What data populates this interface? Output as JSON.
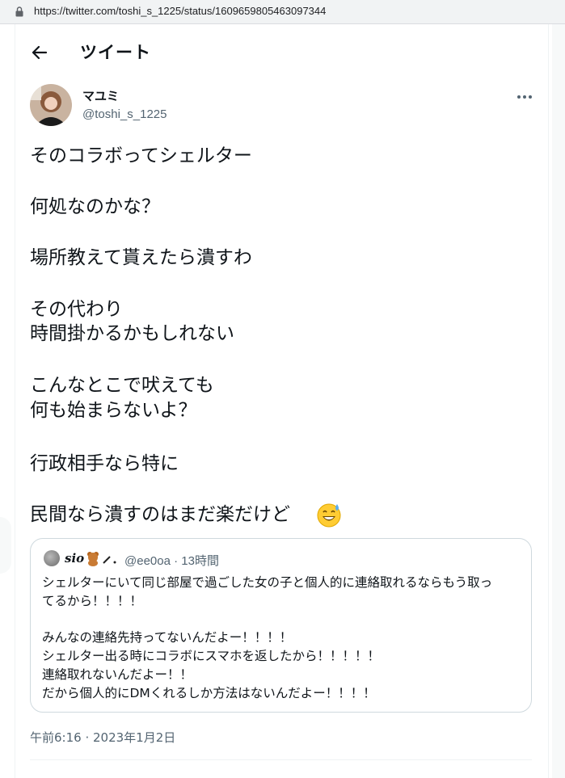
{
  "browser": {
    "url": "https://twitter.com/toshi_s_1225/status/1609659805463097344",
    "lock_icon": "lock-icon"
  },
  "header": {
    "back_icon": "arrow-left-icon",
    "title": "ツイート"
  },
  "tweet": {
    "author": {
      "display_name": "マユミ",
      "handle": "@toshi_s_1225"
    },
    "more_icon": "more-horizontal-icon",
    "lines": [
      "そのコラボってシェルター",
      "何処なのかな？",
      "場所教えて貰えたら潰すわ",
      "その代わり",
      "時間掛かるかもしれない",
      "こんなとこで吠えても",
      "何も始まらないよ？",
      "行政相手なら特に",
      "民間なら潰すのはまだ楽だけど"
    ],
    "trailing_emoji": "grinning-face-with-sweat-emoji",
    "timestamp": "午前6:16 · 2023年1月2日"
  },
  "quote": {
    "author_name": "sio",
    "name_decoration": "teddy-bear-emoji",
    "handle_time": "@ee0oa · 13時間",
    "lines": [
      "シェルターにいて同じ部屋で過ごした女の子と個人的に連絡取れるならもう取っ",
      "てるから！！！！",
      "みんなの連絡先持ってないんだよー！！！！",
      "シェルター出る時にコラボにスマホを返したから！！！！！",
      "連絡取れないんだよー！！",
      "だから個人的にDMくれるしか方法はないんだよー！！！！"
    ]
  },
  "colors": {
    "text": "#0f1419",
    "secondary": "#536471",
    "border": "#cfd9de"
  }
}
